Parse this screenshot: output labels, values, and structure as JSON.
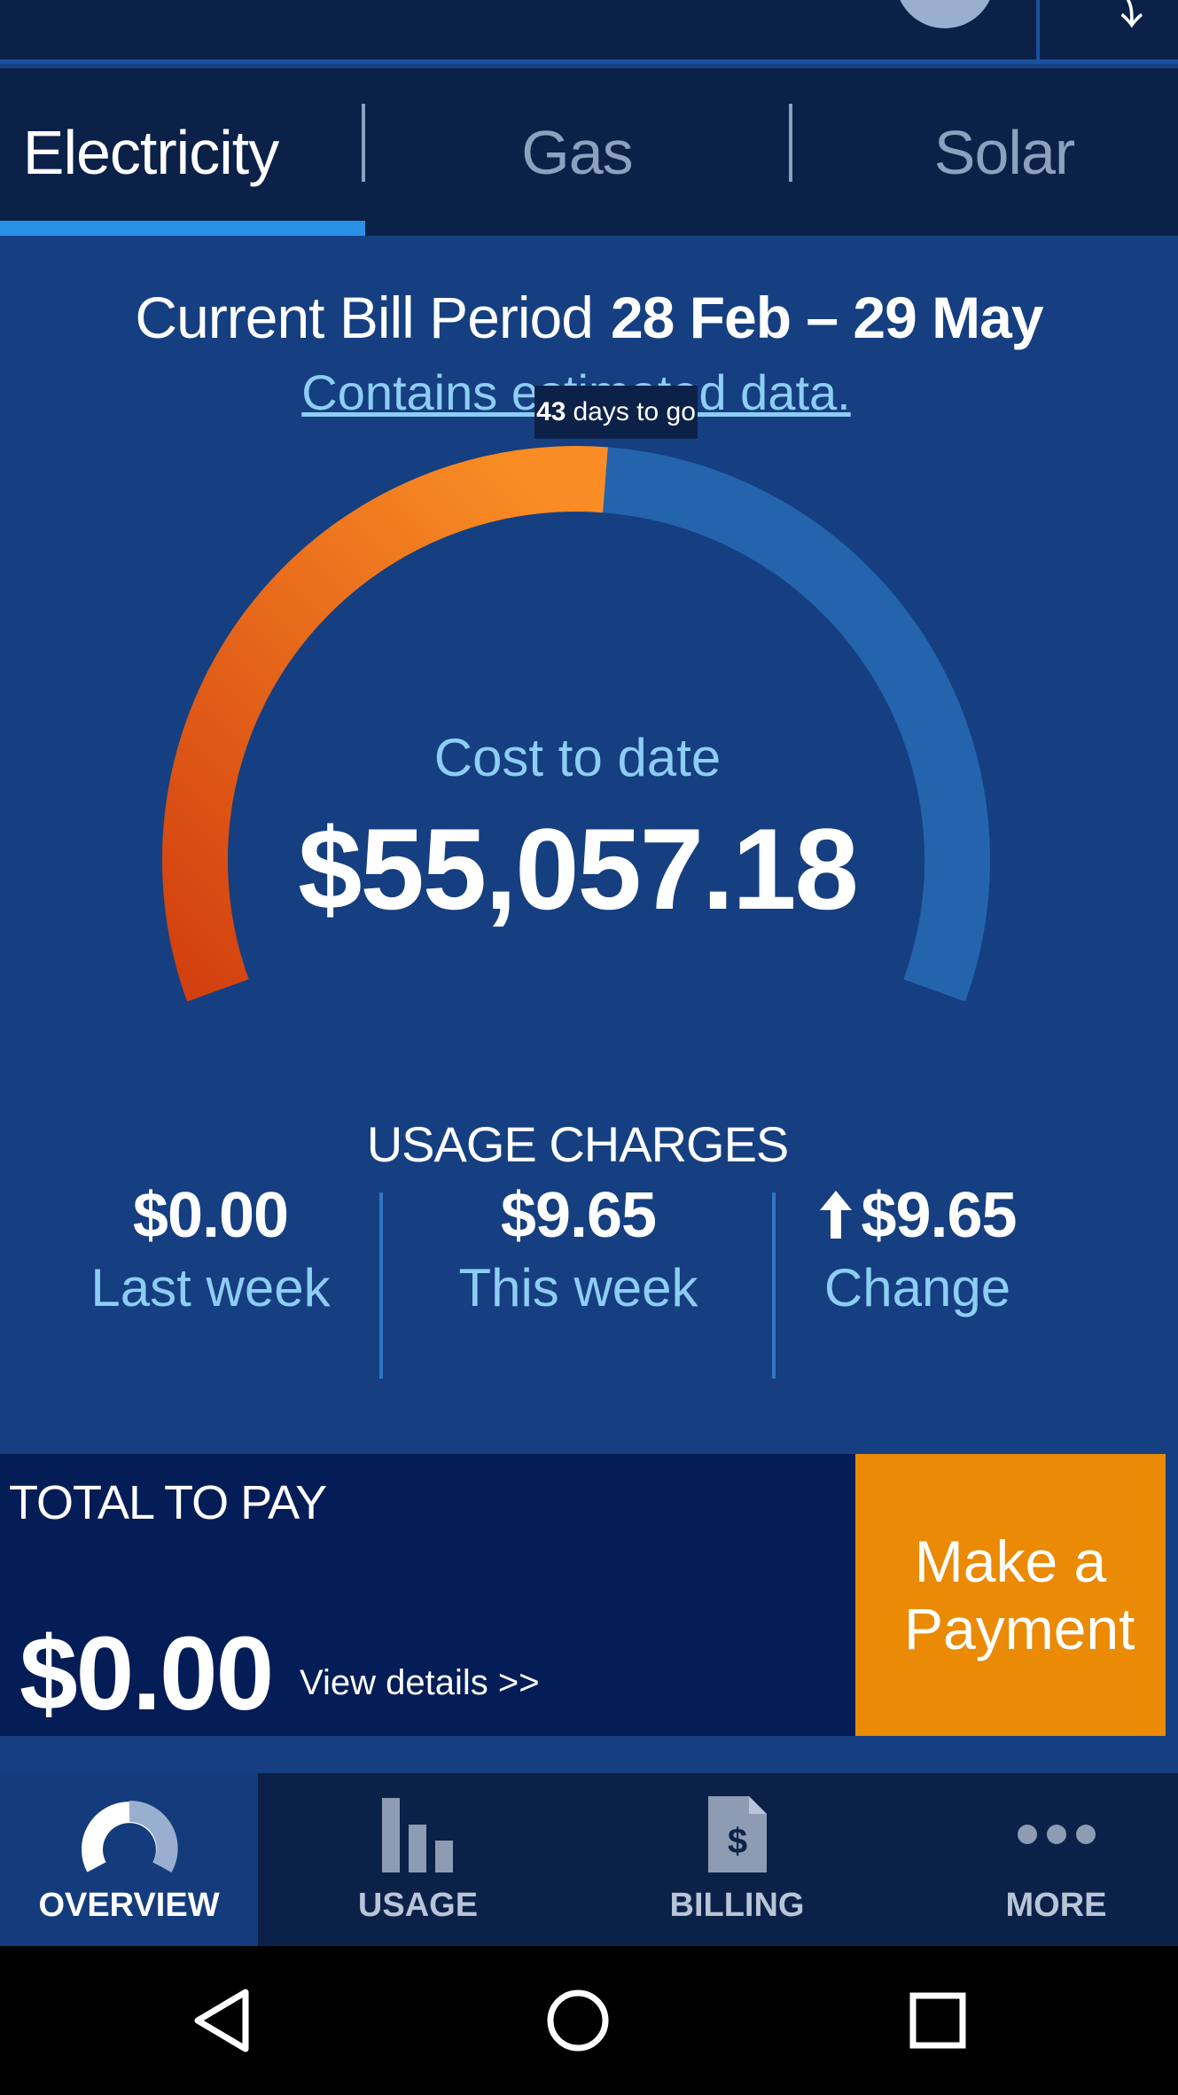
{
  "tabs": [
    {
      "label": "Electricity",
      "active": true
    },
    {
      "label": "Gas",
      "active": false
    },
    {
      "label": "Solar",
      "active": false
    }
  ],
  "bill": {
    "period_label": "Current Bill Period",
    "period_range": "28 Feb – 29 May",
    "estimated_note": "Contains estimated data.",
    "days_to_go": "43",
    "days_to_go_label": "days to go",
    "elapsed_fraction": 0.52
  },
  "cost": {
    "label": "Cost to date",
    "value": "$55,057.18"
  },
  "usage": {
    "title": "USAGE CHARGES",
    "last_week_value": "$0.00",
    "last_week_label": "Last week",
    "this_week_value": "$9.65",
    "this_week_label": "This week",
    "change_value": "$9.65",
    "change_label": "Change",
    "change_icon": "arrow-up-icon"
  },
  "payment": {
    "title": "TOTAL TO PAY",
    "amount": "$0.00",
    "view_details": "View details >>",
    "button_label": "Make a Payment"
  },
  "nav": [
    {
      "label": "OVERVIEW",
      "icon": "gauge-icon",
      "active": true
    },
    {
      "label": "USAGE",
      "icon": "bar-chart-icon",
      "active": false
    },
    {
      "label": "BILLING",
      "icon": "bill-document-icon",
      "active": false
    },
    {
      "label": "MORE",
      "icon": "more-dots-icon",
      "active": false
    }
  ],
  "colors": {
    "background": "#153f80",
    "dark_panel": "#0c2148",
    "accent_blue": "#2990e8",
    "gauge_elapsed_start": "#d2400f",
    "gauge_elapsed_end": "#f98c25",
    "gauge_remaining": "#2364ad",
    "payment_button": "#ea8a05"
  }
}
